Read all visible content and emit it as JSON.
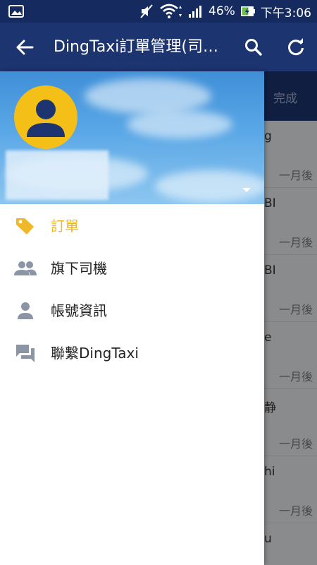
{
  "status_bar": {
    "battery": "46%",
    "time": "下午3:06"
  },
  "app_bar": {
    "title": "DingTaxi訂單管理(司…"
  },
  "background_list": {
    "tab_done_label": "完成",
    "rows": [
      {
        "name": "g",
        "time": "一月後"
      },
      {
        "name": "BI",
        "time": "一月後"
      },
      {
        "name": "BI",
        "time": "一月後"
      },
      {
        "name": "e",
        "time": "一月後"
      },
      {
        "name": "静",
        "time": "一月後"
      },
      {
        "name": "hi",
        "time": "一月後"
      },
      {
        "name": "u",
        "time": ""
      }
    ]
  },
  "drawer": {
    "menu": [
      {
        "label": "訂單",
        "icon": "tag-icon",
        "active": true
      },
      {
        "label": "旗下司機",
        "icon": "people-icon",
        "active": false
      },
      {
        "label": "帳號資訊",
        "icon": "person-icon",
        "active": false
      },
      {
        "label": "聯繫DingTaxi",
        "icon": "chat-icon",
        "active": false
      }
    ]
  },
  "colors": {
    "app_bar": "#1c3470",
    "status_bar": "#152a5e",
    "accent": "#f0b829",
    "icon_gray": "#8b95a6",
    "avatar_bg": "#f4bf17"
  }
}
